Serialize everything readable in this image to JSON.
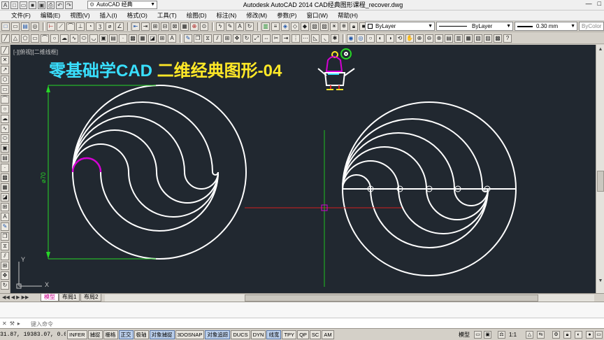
{
  "window": {
    "title": "Autodesk AutoCAD 2014    CAD经典图形课程_recover.dwg",
    "workspace": "AutoCAD 经典",
    "controls": {
      "minimize": "—",
      "maximize": "□"
    }
  },
  "menu": [
    "文件(F)",
    "编辑(E)",
    "视图(V)",
    "插入(I)",
    "格式(O)",
    "工具(T)",
    "绘图(D)",
    "标注(N)",
    "修改(M)",
    "参数(P)",
    "窗口(W)",
    "帮助(H)"
  ],
  "properties": {
    "color": "ByLayer",
    "linetype": "ByLayer",
    "lineweight": "0.30 mm",
    "plotstyle": "ByColor"
  },
  "viewport": {
    "label": "[-][俯视][二维线框]",
    "title_part1": "零基础学CAD",
    "title_part2": "二维经典图形-04",
    "dimension_text": "⌀70",
    "ucs_y": "Y",
    "ucs_x": "X"
  },
  "layout_tabs": [
    "模型",
    "布局1",
    "布局2"
  ],
  "command": {
    "history": "",
    "placeholder": "键入命令"
  },
  "status": {
    "coords": "31.87, 19383.07, 0.00",
    "toggles": [
      {
        "label": "INFER",
        "on": false
      },
      {
        "label": "捕捉",
        "on": false
      },
      {
        "label": "栅格",
        "on": false
      },
      {
        "label": "正交",
        "on": true
      },
      {
        "label": "极轴",
        "on": false
      },
      {
        "label": "对象捕捉",
        "on": true
      },
      {
        "label": "3DOSNAP",
        "on": false
      },
      {
        "label": "对象追踪",
        "on": true
      },
      {
        "label": "DUCS",
        "on": false
      },
      {
        "label": "DYN",
        "on": false
      },
      {
        "label": "线宽",
        "on": true
      },
      {
        "label": "TPY",
        "on": false
      },
      {
        "label": "QP",
        "on": false
      },
      {
        "label": "SC",
        "on": false
      },
      {
        "label": "AM",
        "on": false
      }
    ],
    "model": "模型",
    "scale": "1:1"
  },
  "colors": {
    "canvas_bg": "#212830",
    "geometry": "#ffffff",
    "highlight_arc": "#d400d4",
    "dimension": "#27d827",
    "crosshair_red": "#d42020",
    "crosshair_green": "#20c020"
  }
}
